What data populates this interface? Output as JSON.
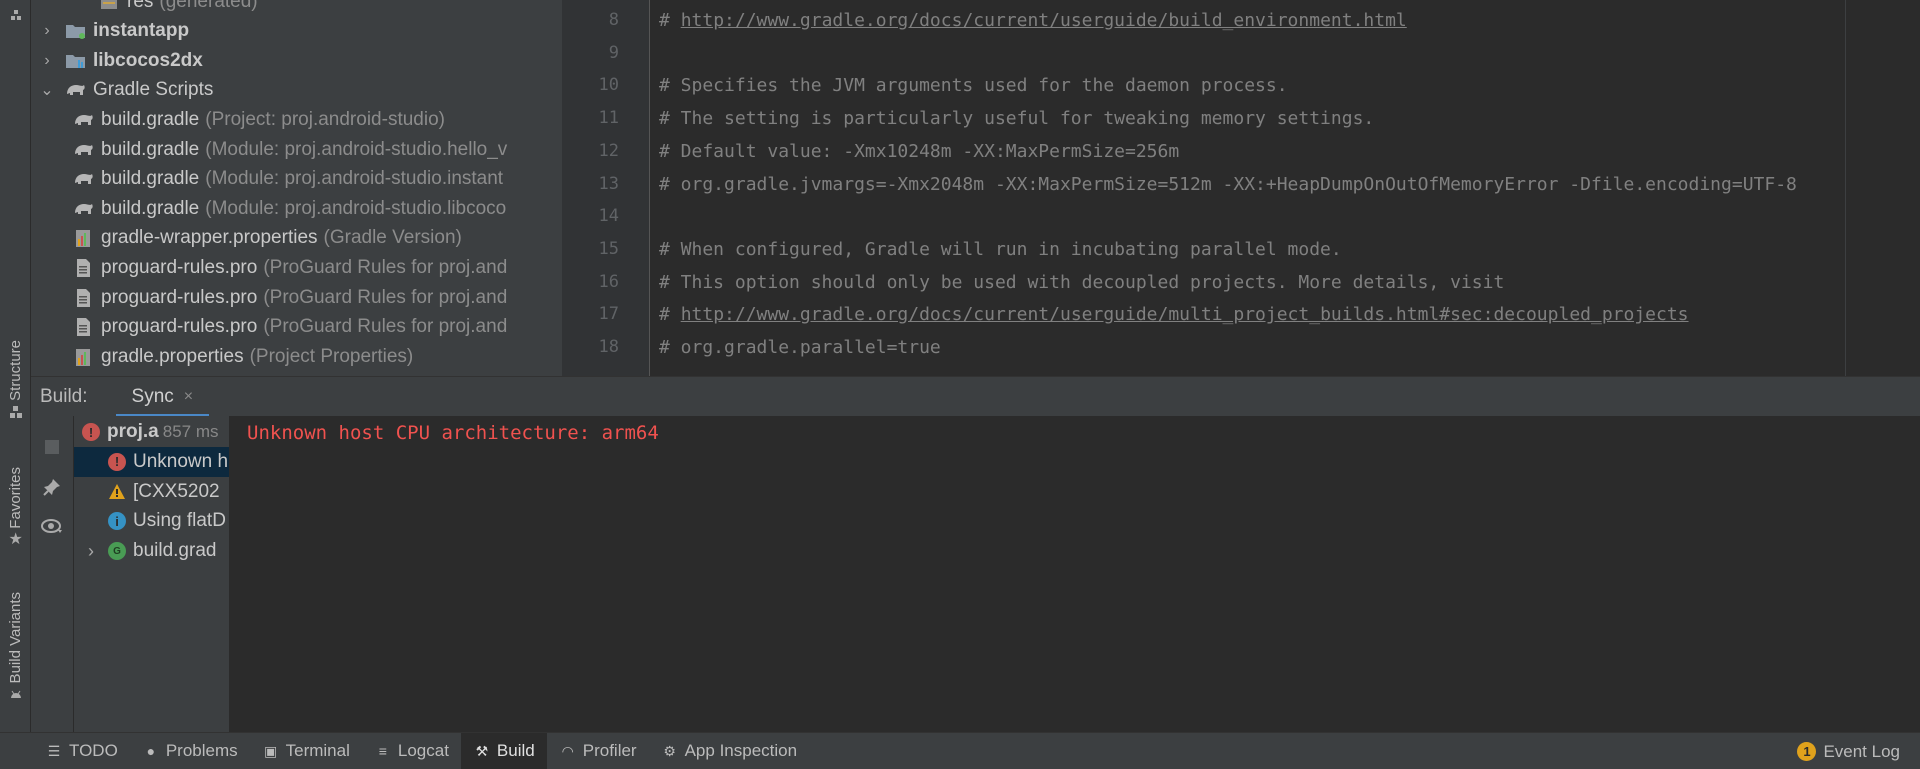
{
  "left_stripe": {
    "tabs": [
      {
        "label": "Structure",
        "icon": "structure-icon"
      },
      {
        "label": "Favorites",
        "icon": "star-icon"
      },
      {
        "label": "Build Variants",
        "icon": "android-icon"
      }
    ]
  },
  "project_tree": {
    "items": [
      {
        "name": "res",
        "hint": "(generated)",
        "indent": 3,
        "icon": "res-folder-icon",
        "bold": false
      },
      {
        "name": "instantapp",
        "hint": "",
        "indent": 1,
        "icon": "module-folder-icon",
        "bold": true,
        "chevron": "›"
      },
      {
        "name": "libcocos2dx",
        "hint": "",
        "indent": 1,
        "icon": "library-folder-icon",
        "bold": true,
        "chevron": "›"
      },
      {
        "name": "Gradle Scripts",
        "hint": "",
        "indent": 1,
        "icon": "gradle-icon",
        "bold": false,
        "chevron": "⌄"
      },
      {
        "name": "build.gradle",
        "hint": "(Project: proj.android-studio)",
        "indent": 2,
        "icon": "gradle-icon",
        "bold": false
      },
      {
        "name": "build.gradle",
        "hint": "(Module: proj.android-studio.hello_v",
        "indent": 2,
        "icon": "gradle-icon",
        "bold": false
      },
      {
        "name": "build.gradle",
        "hint": "(Module: proj.android-studio.instant",
        "indent": 2,
        "icon": "gradle-icon",
        "bold": false
      },
      {
        "name": "build.gradle",
        "hint": "(Module: proj.android-studio.libcoco",
        "indent": 2,
        "icon": "gradle-icon",
        "bold": false
      },
      {
        "name": "gradle-wrapper.properties",
        "hint": "(Gradle Version)",
        "indent": 2,
        "icon": "properties-icon",
        "bold": false
      },
      {
        "name": "proguard-rules.pro",
        "hint": "(ProGuard Rules for proj.and",
        "indent": 2,
        "icon": "text-file-icon",
        "bold": false
      },
      {
        "name": "proguard-rules.pro",
        "hint": "(ProGuard Rules for proj.and",
        "indent": 2,
        "icon": "text-file-icon",
        "bold": false
      },
      {
        "name": "proguard-rules.pro",
        "hint": "(ProGuard Rules for proj.and",
        "indent": 2,
        "icon": "text-file-icon",
        "bold": false
      },
      {
        "name": "gradle.properties",
        "hint": "(Project Properties)",
        "indent": 2,
        "icon": "properties-icon",
        "bold": false
      }
    ]
  },
  "editor": {
    "lines": [
      {
        "num": "8",
        "prefix": "# ",
        "text": "http://www.gradle.org/docs/current/userguide/build_environment.html",
        "link": true
      },
      {
        "num": "9",
        "prefix": "",
        "text": "",
        "link": false
      },
      {
        "num": "10",
        "prefix": "",
        "text": "# Specifies the JVM arguments used for the daemon process.",
        "link": false
      },
      {
        "num": "11",
        "prefix": "",
        "text": "# The setting is particularly useful for tweaking memory settings.",
        "link": false
      },
      {
        "num": "12",
        "prefix": "",
        "text": "# Default value: -Xmx10248m -XX:MaxPermSize=256m",
        "link": false
      },
      {
        "num": "13",
        "prefix": "",
        "text": "# org.gradle.jvmargs=-Xmx2048m -XX:MaxPermSize=512m -XX:+HeapDumpOnOutOfMemoryError -Dfile.encoding=UTF-8",
        "link": false
      },
      {
        "num": "14",
        "prefix": "",
        "text": "",
        "link": false
      },
      {
        "num": "15",
        "prefix": "",
        "text": "# When configured, Gradle will run in incubating parallel mode.",
        "link": false
      },
      {
        "num": "16",
        "prefix": "",
        "text": "# This option should only be used with decoupled projects. More details, visit",
        "link": false
      },
      {
        "num": "17",
        "prefix": "# ",
        "text": "http://www.gradle.org/docs/current/userguide/multi_project_builds.html#sec:decoupled_projects",
        "link": true
      },
      {
        "num": "18",
        "prefix": "",
        "text": "# org.gradle.parallel=true",
        "link": false
      }
    ]
  },
  "build_panel": {
    "title": "Build:",
    "tab_label": "Sync",
    "tab_close": "×",
    "tree": [
      {
        "text": "proj.a",
        "time": "857 ms",
        "icon": "error-icon",
        "color": "#c75450",
        "glyph": "!",
        "indent": 0,
        "bold": true,
        "selected": false
      },
      {
        "text": "Unknown h",
        "time": "",
        "icon": "error-icon",
        "color": "#c75450",
        "glyph": "!",
        "indent": 1,
        "bold": false,
        "selected": true
      },
      {
        "text": "[CXX5202",
        "time": "",
        "icon": "warning-icon",
        "color": "#e0a21c",
        "glyph": "!",
        "indent": 1,
        "bold": false,
        "selected": false
      },
      {
        "text": "Using flatD",
        "time": "",
        "icon": "info-icon",
        "color": "#3592c4",
        "glyph": "i",
        "indent": 1,
        "bold": false,
        "selected": false
      },
      {
        "text": "build.grad",
        "time": "",
        "icon": "gradle-task-icon",
        "color": "#499c54",
        "glyph": "G",
        "indent": 1,
        "bold": false,
        "selected": false,
        "chevron": "›"
      }
    ],
    "output_message": "Unknown host CPU architecture: arm64"
  },
  "bottom_stripe": {
    "items": [
      {
        "label": "TODO",
        "icon": "list-icon",
        "glyph": "☰",
        "active": false
      },
      {
        "label": "Problems",
        "icon": "problems-icon",
        "glyph": "●",
        "active": false
      },
      {
        "label": "Terminal",
        "icon": "terminal-icon",
        "glyph": "▣",
        "active": false
      },
      {
        "label": "Logcat",
        "icon": "logcat-icon",
        "glyph": "≡",
        "active": false
      },
      {
        "label": "Build",
        "icon": "hammer-icon",
        "glyph": "⚒",
        "active": true
      },
      {
        "label": "Profiler",
        "icon": "gauge-icon",
        "glyph": "◠",
        "active": false
      },
      {
        "label": "App Inspection",
        "icon": "inspection-icon",
        "glyph": "⚙",
        "active": false
      }
    ],
    "event_log": {
      "label": "Event Log",
      "count": "1"
    }
  },
  "colors": {
    "accent": "#4a88c7",
    "error_text": "#f0524f",
    "selection": "#0d293e"
  }
}
